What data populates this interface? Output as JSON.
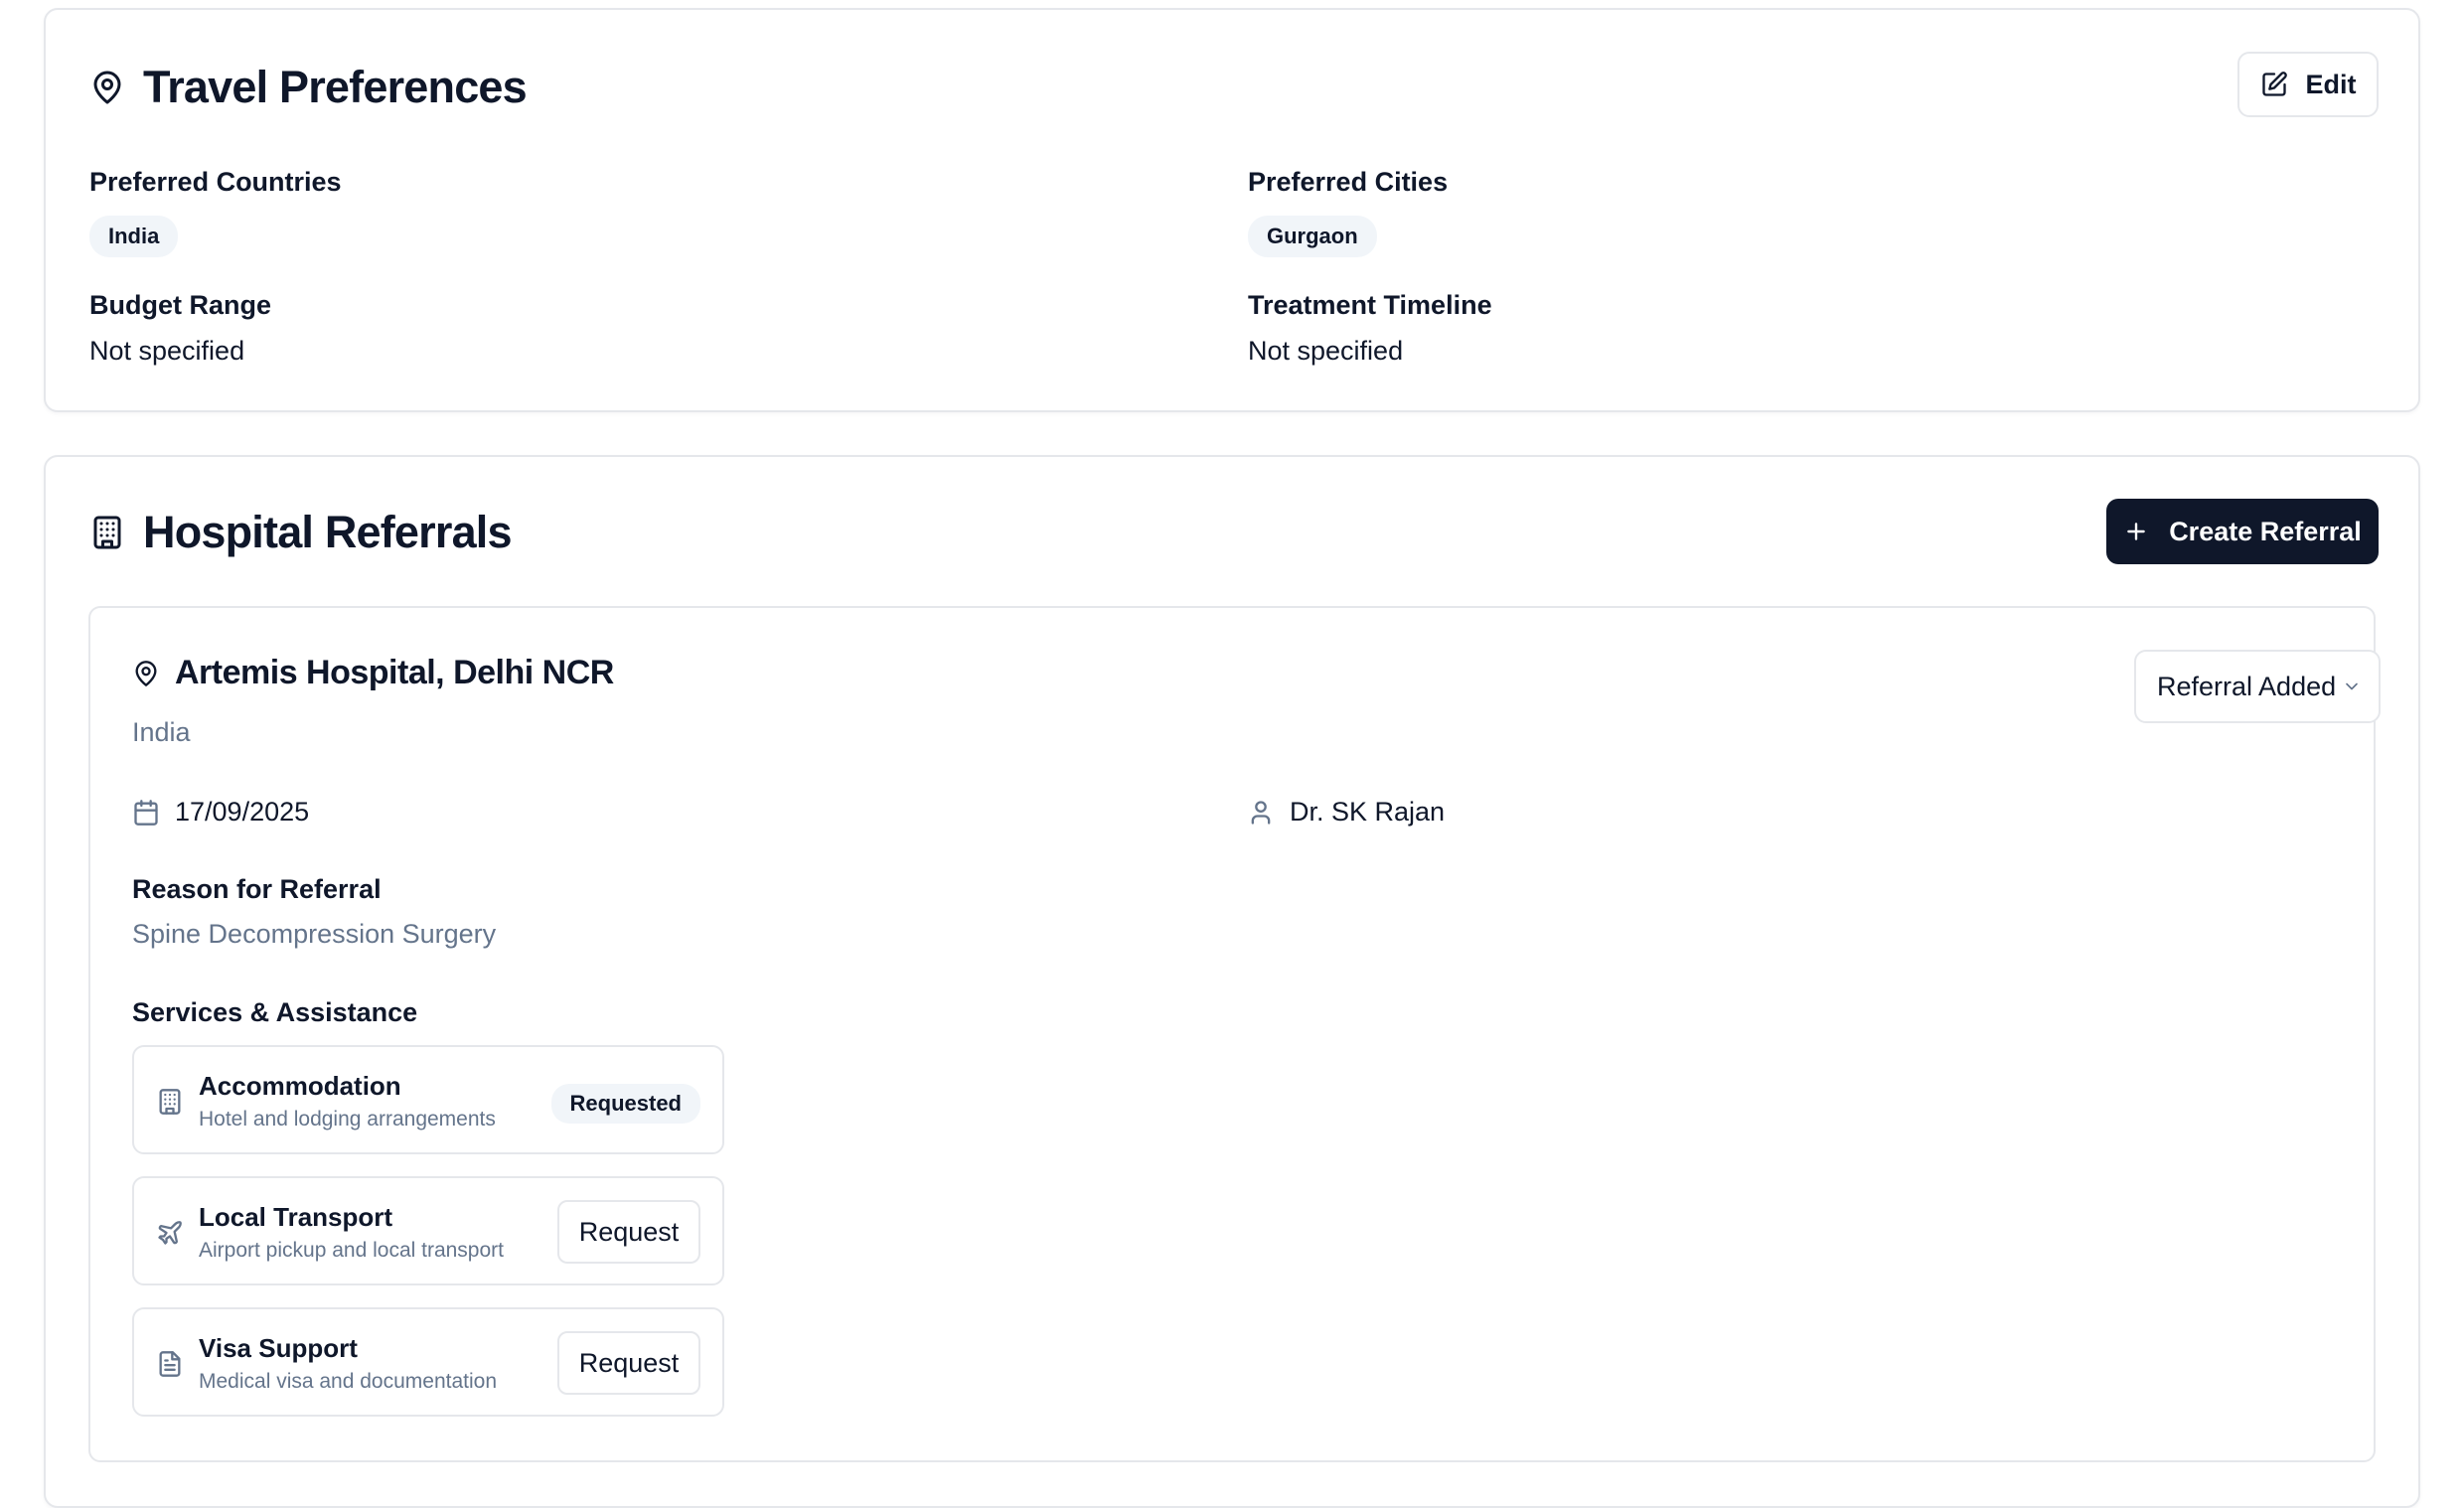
{
  "travel_preferences": {
    "title": "Travel Preferences",
    "edit_label": "Edit",
    "preferred_countries_label": "Preferred Countries",
    "preferred_countries": [
      "India"
    ],
    "preferred_cities_label": "Preferred Cities",
    "preferred_cities": [
      "Gurgaon"
    ],
    "budget_range_label": "Budget Range",
    "budget_range_value": "Not specified",
    "treatment_timeline_label": "Treatment Timeline",
    "treatment_timeline_value": "Not specified"
  },
  "hospital_referrals": {
    "title": "Hospital Referrals",
    "create_label": "Create Referral",
    "referral": {
      "hospital_name": "Artemis Hospital, Delhi NCR",
      "country": "India",
      "status": "Referral Added",
      "date": "17/09/2025",
      "doctor": "Dr. SK Rajan",
      "reason_label": "Reason for Referral",
      "reason": "Spine Decompression Surgery",
      "services_label": "Services & Assistance",
      "services": [
        {
          "title": "Accommodation",
          "description": "Hotel and lodging arrangements",
          "status": "Requested",
          "icon": "building-icon"
        },
        {
          "title": "Local Transport",
          "description": "Airport pickup and local transport",
          "action": "Request",
          "icon": "plane-icon"
        },
        {
          "title": "Visa Support",
          "description": "Medical visa and documentation",
          "action": "Request",
          "icon": "document-icon"
        }
      ]
    }
  }
}
